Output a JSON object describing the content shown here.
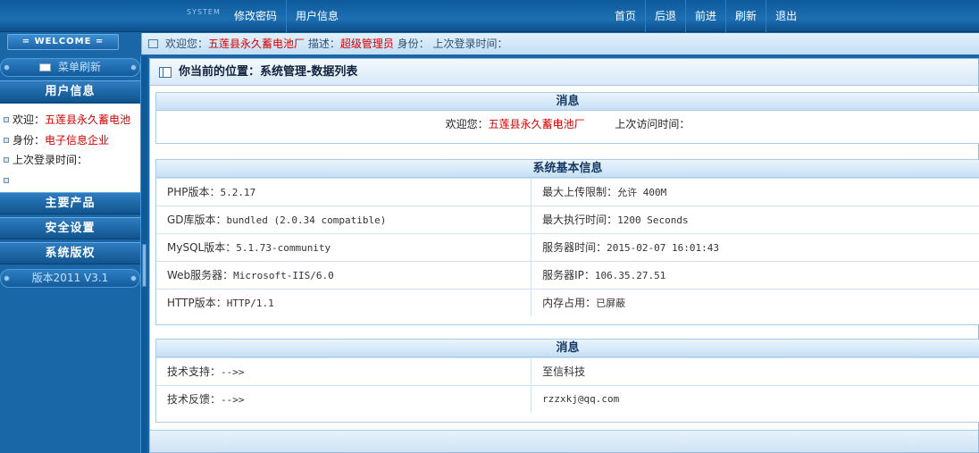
{
  "topbar": {
    "system_tag": "SYSTEM",
    "left_links": [
      "修改密码",
      "用户信息"
    ],
    "right_links": [
      "首页",
      "后退",
      "前进",
      "刷新",
      "退出"
    ]
  },
  "welcome_label": "= WELCOME =",
  "infobar": {
    "greet": "欢迎您：",
    "company": "五莲县永久蓄电池厂",
    "desc_label": " 描述：",
    "role": "超级管理员",
    "rest": " 身份： 上次登录时间："
  },
  "sidebar": {
    "refresh_label": "菜单刷新",
    "user_info_title": "用户信息",
    "user_lines": [
      {
        "label": "欢迎：",
        "value": "五莲县永久蓄电池"
      },
      {
        "label": "身份：",
        "value": "电子信息企业"
      },
      {
        "label": "上次登录时间：",
        "value": ""
      },
      {
        "label": "",
        "value": ""
      }
    ],
    "sections": [
      "主要产品",
      "安全设置",
      "系统版权"
    ],
    "version_label": "版本2011 V3.1"
  },
  "main": {
    "breadcrumb": "你当前的位置：系统管理-数据列表",
    "message_box": {
      "title": "消息",
      "greet": "欢迎您：",
      "company": "五莲县永久蓄电池厂",
      "last_visit": "上次访问时间："
    },
    "sysinfo_box": {
      "title": "系统基本信息",
      "rows": [
        [
          {
            "k": "PHP版本：",
            "v": "5.2.17"
          },
          {
            "k": "最大上传限制：",
            "v": "允许 400M"
          }
        ],
        [
          {
            "k": "GD库版本：",
            "v": "bundled (2.0.34 compatible)"
          },
          {
            "k": "最大执行时间：",
            "v": "1200 Seconds"
          }
        ],
        [
          {
            "k": "MySQL版本：",
            "v": "5.1.73-community"
          },
          {
            "k": "服务器时间：",
            "v": "2015-02-07  16:01:43"
          }
        ],
        [
          {
            "k": "Web服务器：",
            "v": "Microsoft-IIS/6.0"
          },
          {
            "k": "服务器IP：",
            "v": "106.35.27.51"
          }
        ],
        [
          {
            "k": "HTTP版本：",
            "v": "HTTP/1.1"
          },
          {
            "k": "内存占用：",
            "v": "已屏蔽"
          }
        ]
      ]
    },
    "support_box": {
      "title": "消息",
      "rows": [
        [
          {
            "k": "技术支持：",
            "v": "-->>"
          },
          {
            "k": "",
            "v": "至信科技"
          }
        ],
        [
          {
            "k": "技术反馈：",
            "v": "-->>"
          },
          {
            "k": "",
            "v": "rzzxkj@qq.com"
          }
        ]
      ]
    }
  },
  "colors": {
    "accent_red": "#d40000",
    "nav_blue": "#1a67a8"
  }
}
